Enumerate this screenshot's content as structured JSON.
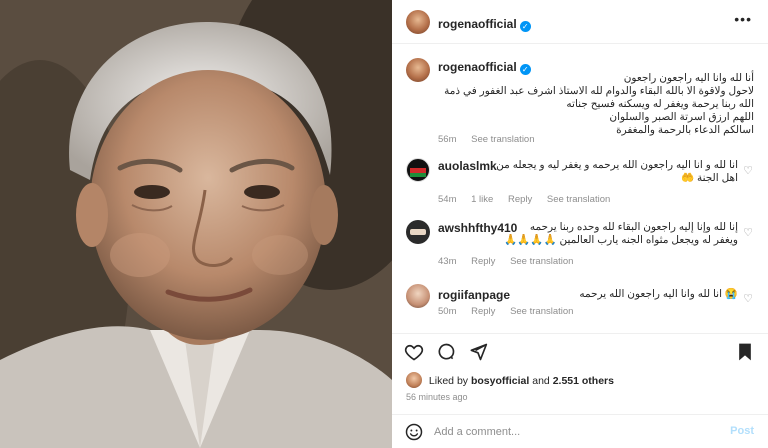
{
  "post": {
    "photo_alt": "Elderly man portrait",
    "author": "rogenaofficial",
    "verified": true,
    "caption_lines": [
      "أنا لله وانا اليه راجعون راجعون",
      "لاحول ولاقوة الا بالله البقاء والدوام لله الاستاذ اشرف عبد الغفور في ذمة",
      "الله ربنا يرحمة ويغفر له ويسكنه فسيح جناته",
      "اللهم ارزق اسرتة الصبر والسلوان",
      "اسالكم الدعاء بالرحمة والمغفرة"
    ],
    "caption_time": "56m",
    "see_translation": "See translation"
  },
  "comments": [
    {
      "user": "auolaslmk",
      "lines": [
        "انا لله و انا اليه راجعون الله يرحمه و يغفر ليه و يجعله من",
        "اهل الجنة 🤲"
      ],
      "time": "54m",
      "likes": "1 like",
      "reply": "Reply",
      "translate": "See translation"
    },
    {
      "user": "awshhfthy410",
      "lines": [
        "إنا لله وإنا إليه راجعون البقاء لله وحده ربنا يرحمه",
        "ويغفر له ويجعل مثواه الجنه يارب العالمين 🙏🙏🙏🙏"
      ],
      "time": "43m",
      "reply": "Reply",
      "translate": "See translation"
    },
    {
      "user": "rogiifanpage",
      "lines": [
        "😭 انا لله وانا اليه راجعون الله يرحمه"
      ],
      "time": "50m",
      "reply": "Reply",
      "translate": "See translation"
    }
  ],
  "likes": {
    "prefix": "Liked by",
    "user": "bosyofficial",
    "conj": "and",
    "count": "2.551 others"
  },
  "time_ago": "56 minutes ago",
  "add_comment": {
    "placeholder": "Add a comment...",
    "post_label": "Post"
  },
  "icons": [
    "more-icon",
    "heart-icon",
    "comment-icon",
    "share-icon",
    "bookmark-icon",
    "emoji-icon",
    "verified-icon"
  ],
  "colors": {
    "verified_blue": "#0095f6",
    "muted": "#8e8e8e",
    "post_disabled": "#b2dffc"
  }
}
